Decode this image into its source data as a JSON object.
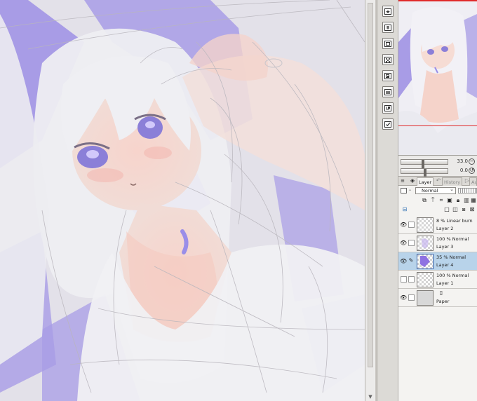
{
  "tools": [
    {
      "name": "favorites-folder-icon"
    },
    {
      "name": "layer-set-folder-icon"
    },
    {
      "name": "layer-stack-icon"
    },
    {
      "name": "texture-layer-icon"
    },
    {
      "name": "layer-copy-icon"
    },
    {
      "name": "mask-layer-icon"
    },
    {
      "name": "clip-layer-icon"
    },
    {
      "name": "check-box-icon"
    }
  ],
  "navigator": {
    "zoom_value": "33.0",
    "angle_value": "0.0",
    "zoom_fraction": 0.45,
    "angle_fraction": 0.5
  },
  "layer_panel": {
    "tabs": [
      {
        "label": "Layer",
        "state": "active"
      },
      {
        "label": "History",
        "state": "inactive"
      },
      {
        "label": "Au",
        "state": "inactive"
      }
    ],
    "blend_mode": "Normal",
    "layers": [
      {
        "mode": "8 % Linear burn",
        "name": "Layer 2",
        "visible": true,
        "selected": false
      },
      {
        "mode": "100 % Normal",
        "name": "Layer 3",
        "visible": true,
        "selected": false
      },
      {
        "mode": "35 % Normal",
        "name": "Layer 4",
        "visible": true,
        "selected": true
      },
      {
        "mode": "100 % Normal",
        "name": "Layer 1",
        "visible": false,
        "selected": false
      },
      {
        "mode": "",
        "name": "Paper",
        "visible": true,
        "selected": false
      }
    ]
  },
  "colors": {
    "accent_purple": "#a89ce6",
    "selection_blue": "#b8d3ea",
    "nav_frame_red": "#e02a2a"
  }
}
